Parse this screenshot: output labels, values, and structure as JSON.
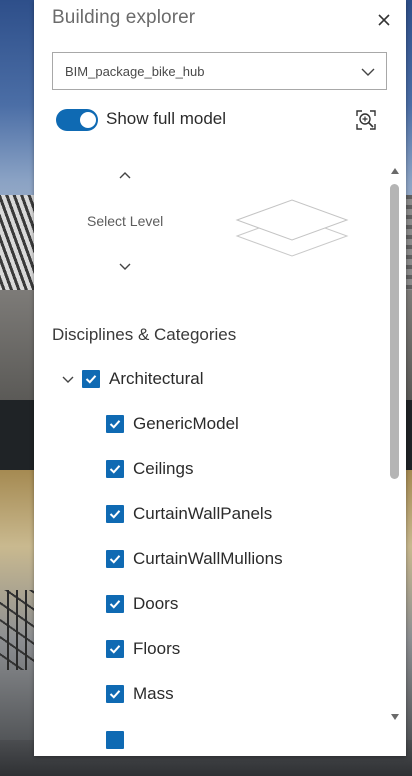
{
  "panel": {
    "title": "Building explorer",
    "close_icon": "close-icon",
    "layer_select": {
      "value": "BIM_package_bike_hub"
    },
    "toggle": {
      "label": "Show full model",
      "checked": true
    },
    "zoom_icon": "zoom-to-icon",
    "level_selector": {
      "label": "Select Level"
    },
    "disciplines": {
      "heading": "Disciplines & Categories",
      "group": {
        "label": "Architectural",
        "checked": true,
        "expanded": true
      },
      "categories": [
        {
          "label": "GenericModel",
          "checked": true
        },
        {
          "label": "Ceilings",
          "checked": true
        },
        {
          "label": "CurtainWallPanels",
          "checked": true
        },
        {
          "label": "CurtainWallMullions",
          "checked": true
        },
        {
          "label": "Doors",
          "checked": true
        },
        {
          "label": "Floors",
          "checked": true
        },
        {
          "label": "Mass",
          "checked": true
        }
      ]
    }
  },
  "colors": {
    "accent": "#0f6ab3",
    "text": "#2b2b2b",
    "muted": "#6b6b6b"
  }
}
